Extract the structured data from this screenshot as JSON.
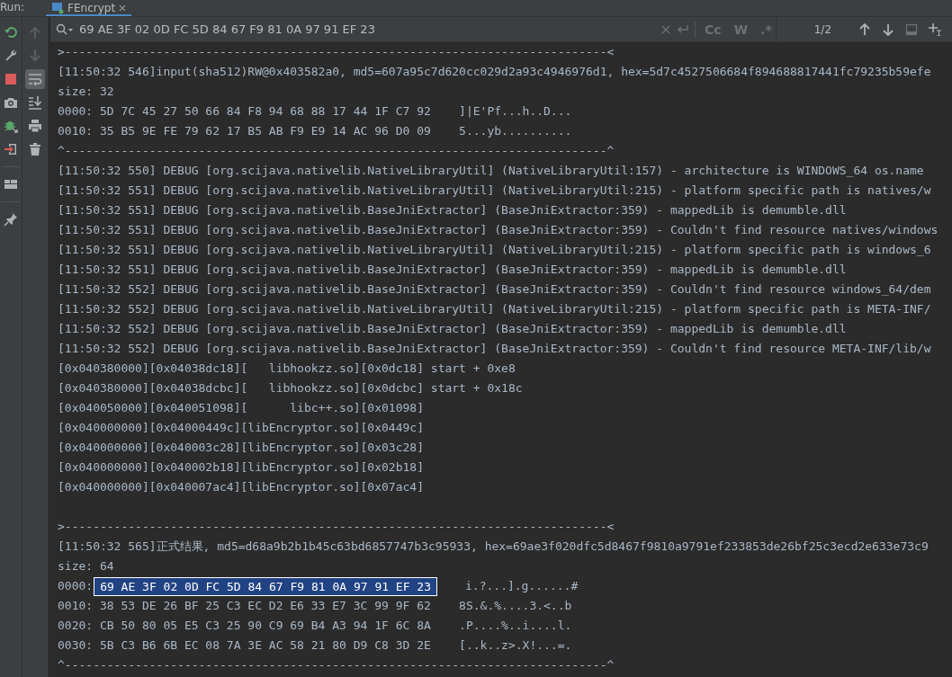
{
  "run_panel": {
    "label": "Run:",
    "tabs": [
      {
        "label": "FEncrypt",
        "selected": true
      }
    ]
  },
  "left_toolbar": [
    {
      "kind": "rerun"
    },
    {
      "kind": "wrench"
    },
    {
      "kind": "stop"
    },
    {
      "kind": "camera"
    },
    {
      "kind": "bug"
    },
    {
      "kind": "exit"
    },
    {
      "kind": "separator"
    },
    {
      "kind": "layout"
    },
    {
      "kind": "separator"
    },
    {
      "kind": "pin"
    }
  ],
  "console_toolbar": [
    {
      "kind": "up",
      "disabled": true
    },
    {
      "kind": "down",
      "disabled": true
    },
    {
      "kind": "wrap",
      "selected": true
    },
    {
      "kind": "scroll-end",
      "selected": false
    },
    {
      "kind": "print"
    },
    {
      "kind": "trash"
    }
  ],
  "search": {
    "query": "69 AE 3F 02 0D FC 5D 84 67 F9 81 0A 97 91 EF 23",
    "options": [
      "Cc",
      "W",
      ".*"
    ],
    "match_count": "1/2"
  },
  "console": [
    {
      "kind": "text",
      "text": ">-----------------------------------------------------------------------------<"
    },
    {
      "kind": "text",
      "text": "[11:50:32 546]input(sha512)RW@0x403582a0, md5=607a95c7d620cc029d2a93c4946976d1, hex=5d7c4527506684f894688817441fc79235b59efe"
    },
    {
      "kind": "text",
      "text": "size: 32"
    },
    {
      "kind": "text",
      "text": "0000: 5D 7C 45 27 50 66 84 F8 94 68 88 17 44 1F C7 92    ]|E'Pf...h..D..."
    },
    {
      "kind": "text",
      "text": "0010: 35 B5 9E FE 79 62 17 B5 AB F9 E9 14 AC 96 D0 09    5...yb.........."
    },
    {
      "kind": "text",
      "text": "^-----------------------------------------------------------------------------^"
    },
    {
      "kind": "text",
      "text": "[11:50:32 550] DEBUG [org.scijava.nativelib.NativeLibraryUtil] (NativeLibraryUtil:157) - architecture is WINDOWS_64 os.name"
    },
    {
      "kind": "text",
      "text": "[11:50:32 551] DEBUG [org.scijava.nativelib.NativeLibraryUtil] (NativeLibraryUtil:215) - platform specific path is natives/w"
    },
    {
      "kind": "text",
      "text": "[11:50:32 551] DEBUG [org.scijava.nativelib.BaseJniExtractor] (BaseJniExtractor:359) - mappedLib is demumble.dll"
    },
    {
      "kind": "text",
      "text": "[11:50:32 551] DEBUG [org.scijava.nativelib.BaseJniExtractor] (BaseJniExtractor:359) - Couldn't find resource natives/windows"
    },
    {
      "kind": "text",
      "text": "[11:50:32 551] DEBUG [org.scijava.nativelib.NativeLibraryUtil] (NativeLibraryUtil:215) - platform specific path is windows_6"
    },
    {
      "kind": "text",
      "text": "[11:50:32 551] DEBUG [org.scijava.nativelib.BaseJniExtractor] (BaseJniExtractor:359) - mappedLib is demumble.dll"
    },
    {
      "kind": "text",
      "text": "[11:50:32 552] DEBUG [org.scijava.nativelib.BaseJniExtractor] (BaseJniExtractor:359) - Couldn't find resource windows_64/dem"
    },
    {
      "kind": "text",
      "text": "[11:50:32 552] DEBUG [org.scijava.nativelib.NativeLibraryUtil] (NativeLibraryUtil:215) - platform specific path is META-INF/"
    },
    {
      "kind": "text",
      "text": "[11:50:32 552] DEBUG [org.scijava.nativelib.BaseJniExtractor] (BaseJniExtractor:359) - mappedLib is demumble.dll"
    },
    {
      "kind": "text",
      "text": "[11:50:32 552] DEBUG [org.scijava.nativelib.BaseJniExtractor] (BaseJniExtractor:359) - Couldn't find resource META-INF/lib/w"
    },
    {
      "kind": "text",
      "text": "[0x040380000][0x04038dc18][   libhookzz.so][0x0dc18] start + 0xe8"
    },
    {
      "kind": "text",
      "text": "[0x040380000][0x04038dcbc][   libhookzz.so][0x0dcbc] start + 0x18c"
    },
    {
      "kind": "text",
      "text": "[0x040050000][0x040051098][      libc++.so][0x01098]"
    },
    {
      "kind": "text",
      "text": "[0x040000000][0x04000449c][libEncryptor.so][0x0449c]"
    },
    {
      "kind": "text",
      "text": "[0x040000000][0x040003c28][libEncryptor.so][0x03c28]"
    },
    {
      "kind": "text",
      "text": "[0x040000000][0x040002b18][libEncryptor.so][0x02b18]"
    },
    {
      "kind": "text",
      "text": "[0x040000000][0x040007ac4][libEncryptor.so][0x07ac4]"
    },
    {
      "kind": "blank"
    },
    {
      "kind": "text",
      "text": ">-----------------------------------------------------------------------------<"
    },
    {
      "kind": "text",
      "text": "[11:50:32 565]正式结果, md5=d68a9b2b1b45c63bd6857747b3c95933, hex=69ae3f020dfc5d8467f9810a9791ef233853de26bf25c3ecd2e633e73c9"
    },
    {
      "kind": "text",
      "text": "size: 64"
    },
    {
      "kind": "match",
      "prefix": "0000:",
      "match": "69 AE 3F 02 0D FC 5D 84 67 F9 81 0A 97 91 EF 23",
      "suffix": "i.?...].g......#"
    },
    {
      "kind": "text",
      "text": "0010: 38 53 DE 26 BF 25 C3 EC D2 E6 33 E7 3C 99 9F 62    8S.&.%....3.<..b"
    },
    {
      "kind": "text",
      "text": "0020: CB 50 80 05 E5 C3 25 90 C9 69 B4 A3 94 1F 6C 8A    .P....%..i....l."
    },
    {
      "kind": "text",
      "text": "0030: 5B C3 B6 6B EC 08 7A 3E AC 58 21 80 D9 C8 3D 2E    [..k..z>.X!...=."
    },
    {
      "kind": "text",
      "text": "^-----------------------------------------------------------------------------^"
    }
  ]
}
